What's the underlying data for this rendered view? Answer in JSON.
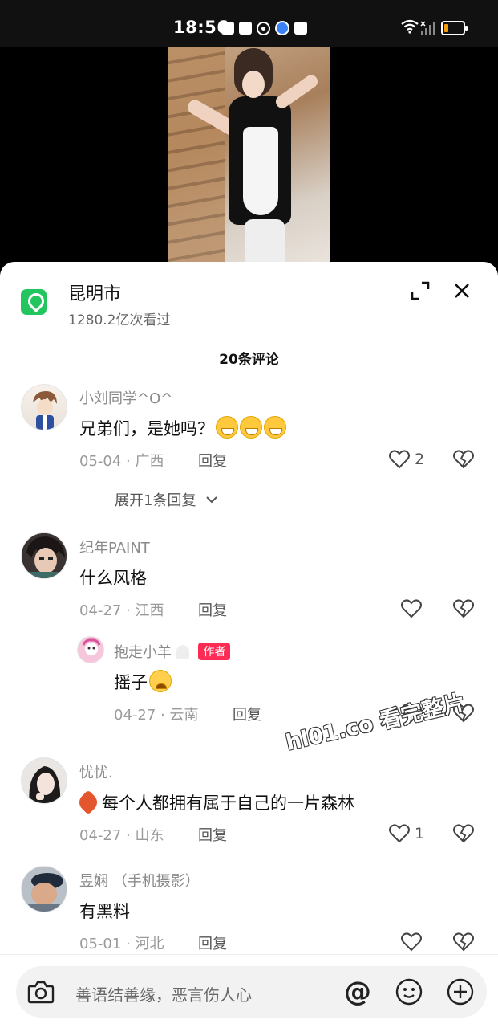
{
  "status_bar": {
    "time": "18:56"
  },
  "location": {
    "name": "昆明市",
    "views": "1280.2亿次看过"
  },
  "comments_header": "20条评论",
  "comments": [
    {
      "user": "小刘同学^O^",
      "text": "兄弟们，是她吗？",
      "date": "05-04 · 广西",
      "reply_label": "回复",
      "likes": "2"
    },
    {
      "user": "纪年PAINT",
      "text": "什么风格",
      "date": "04-27 · 江西",
      "reply_label": "回复",
      "likes": ""
    },
    {
      "user": "抱走小羊",
      "badge": "作者",
      "text": "摇子",
      "date": "04-27 · 云南",
      "reply_label": "回复",
      "likes": ""
    },
    {
      "user": "忧忧.",
      "text": "每个人都拥有属于自己的一片森林",
      "date": "04-27 · 山东",
      "reply_label": "回复",
      "likes": "1"
    },
    {
      "user": "昱娴 （手机摄影）",
      "text": "有黑料",
      "date": "05-01 · 河北",
      "reply_label": "回复",
      "likes": ""
    }
  ],
  "expand_replies": "展开1条回复",
  "watermark": "hl01.co 看完整片",
  "input": {
    "placeholder": "善语结善缘，恶言伤人心",
    "at_symbol": "@"
  },
  "icons": {
    "location": "map-pin-icon",
    "expand": "expand-icon",
    "close": "close-icon",
    "like": "heart-outline-icon",
    "dislike": "broken-heart-icon",
    "camera": "camera-icon",
    "emoji": "smiley-icon",
    "plus": "plus-circle-icon"
  },
  "colors": {
    "accent": "#fe2c55",
    "location_green": "#22c55e",
    "battery": "#f59e0b"
  }
}
